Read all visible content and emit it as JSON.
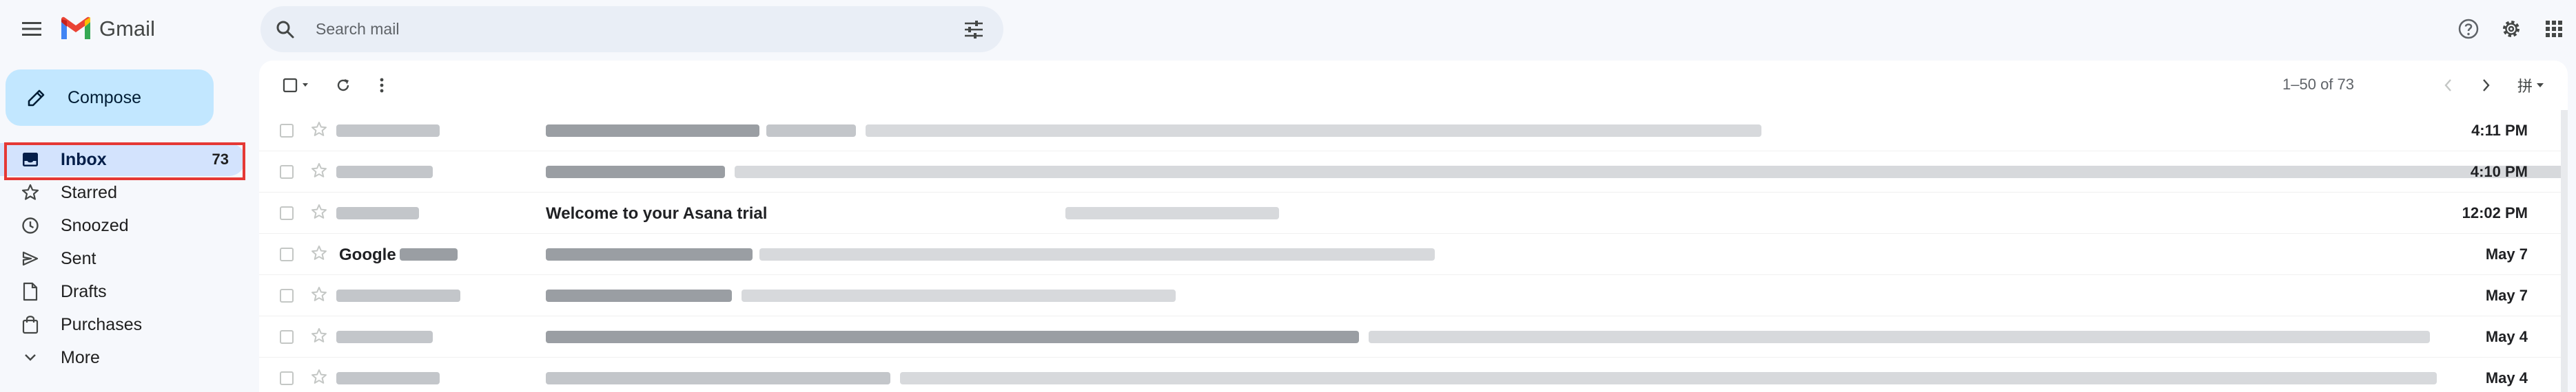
{
  "app": {
    "name": "Gmail"
  },
  "search": {
    "placeholder": "Search mail"
  },
  "sidebar": {
    "compose_label": "Compose",
    "items": [
      {
        "label": "Inbox",
        "count": "73",
        "active": true
      },
      {
        "label": "Starred"
      },
      {
        "label": "Snoozed"
      },
      {
        "label": "Sent"
      },
      {
        "label": "Drafts"
      },
      {
        "label": "Purchases"
      },
      {
        "label": "More"
      }
    ]
  },
  "toolbar": {
    "pager": "1–50 of 73",
    "input_tool": "拼"
  },
  "emails": [
    {
      "sender": "",
      "subject": "",
      "date": "4:11 PM"
    },
    {
      "sender": "",
      "subject": "",
      "date": "4:10 PM"
    },
    {
      "sender": "",
      "subject": "Welcome to your Asana trial",
      "date": "12:02 PM"
    },
    {
      "sender": "Google",
      "subject": "",
      "date": "May 7"
    },
    {
      "sender": "",
      "subject": "",
      "date": "May 7"
    },
    {
      "sender": "",
      "subject": "",
      "date": "May 4"
    },
    {
      "sender": "",
      "subject": "",
      "date": "May 4"
    }
  ],
  "colors": {
    "accent": "#0b57d0",
    "compose_bg": "#c2e7ff",
    "active_bg": "#d3e3fd",
    "highlight": "#e53935"
  }
}
